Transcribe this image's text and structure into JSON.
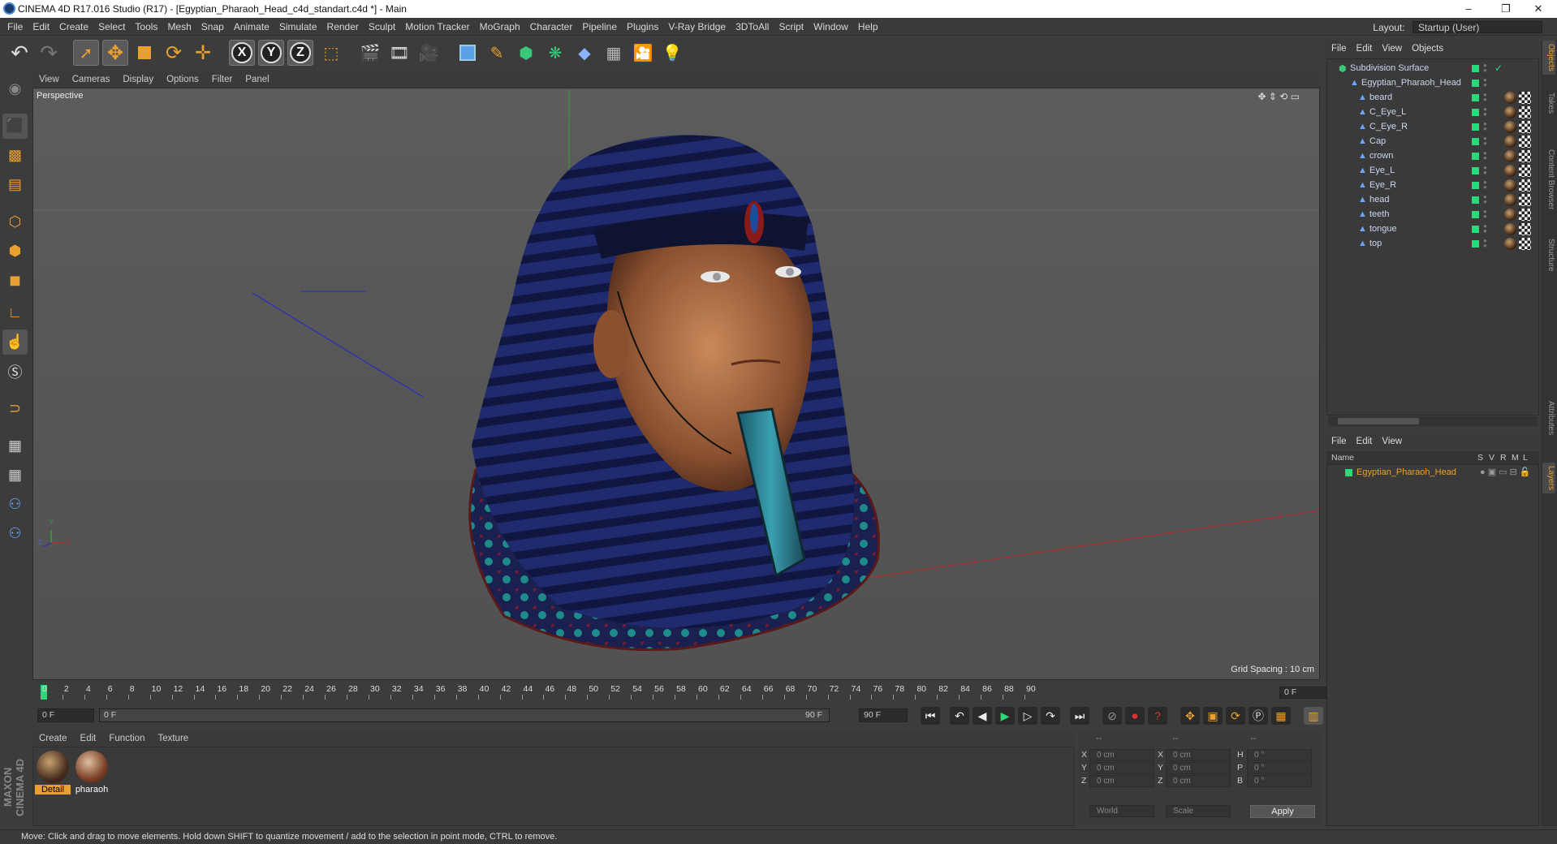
{
  "window": {
    "title": "CINEMA 4D R17.016 Studio (R17) - [Egyptian_Pharaoh_Head_c4d_standart.c4d *] - Main",
    "controls": [
      "–",
      "❐",
      "✕"
    ]
  },
  "menubar": {
    "items": [
      "File",
      "Edit",
      "Create",
      "Select",
      "Tools",
      "Mesh",
      "Snap",
      "Animate",
      "Simulate",
      "Render",
      "Sculpt",
      "Motion Tracker",
      "MoGraph",
      "Character",
      "Pipeline",
      "Plugins",
      "V-Ray Bridge",
      "3DToAll",
      "Script",
      "Window",
      "Help"
    ],
    "layout_label": "Layout:",
    "layout_value": "Startup (User)"
  },
  "toolbar": {
    "axis_x": "X",
    "axis_y": "Y",
    "axis_z": "Z"
  },
  "viewport": {
    "menu": [
      "View",
      "Cameras",
      "Display",
      "Options",
      "Filter",
      "Panel"
    ],
    "label": "Perspective",
    "grid_spacing": "Grid Spacing : 10 cm",
    "axis_y": "Y",
    "axis_x": "X",
    "axis_z": "Z"
  },
  "timeline": {
    "ticks": [
      "0",
      "2",
      "4",
      "6",
      "8",
      "10",
      "12",
      "14",
      "16",
      "18",
      "20",
      "22",
      "24",
      "26",
      "28",
      "30",
      "32",
      "34",
      "36",
      "38",
      "40",
      "42",
      "44",
      "46",
      "48",
      "50",
      "52",
      "54",
      "56",
      "58",
      "60",
      "62",
      "64",
      "66",
      "68",
      "70",
      "72",
      "74",
      "76",
      "78",
      "80",
      "82",
      "84",
      "86",
      "88",
      "90"
    ],
    "current_frame": "0 F",
    "start_field": "0 F",
    "range_start": "0 F",
    "range_end": "90 F",
    "end_field": "90 F"
  },
  "material_manager": {
    "menu": [
      "Create",
      "Edit",
      "Function",
      "Texture"
    ],
    "materials": [
      {
        "name": "Detail",
        "selected": true
      },
      {
        "name": "pharaoh",
        "selected": false
      }
    ]
  },
  "coordinates": {
    "headers": [
      "--",
      "--",
      "--"
    ],
    "rows": [
      {
        "axis": "X",
        "pos": "0 cm",
        "axis2": "X",
        "size": "0 cm",
        "rot_label": "H",
        "rot": "0 °"
      },
      {
        "axis": "Y",
        "pos": "0 cm",
        "axis2": "Y",
        "size": "0 cm",
        "rot_label": "P",
        "rot": "0 °"
      },
      {
        "axis": "Z",
        "pos": "0 cm",
        "axis2": "Z",
        "size": "0 cm",
        "rot_label": "B",
        "rot": "0 °"
      }
    ],
    "mode_world": "World",
    "mode_scale": "Scale",
    "apply": "Apply"
  },
  "status": {
    "text": "Move: Click and drag to move elements. Hold down SHIFT to quantize movement / add to the selection in point mode, CTRL to remove."
  },
  "object_manager": {
    "menu": [
      "File",
      "Edit",
      "View",
      "Objects"
    ],
    "root": "Subdivision Surface",
    "group": "Egyptian_Pharaoh_Head",
    "children": [
      "beard",
      "C_Eye_L",
      "C_Eye_R",
      "Cap",
      "crown",
      "Eye_L",
      "Eye_R",
      "head",
      "teeth",
      "tongue",
      "top"
    ]
  },
  "layer_manager": {
    "menu": [
      "File",
      "Edit",
      "View"
    ],
    "columns": {
      "name": "Name",
      "s": "S",
      "v": "V",
      "r": "R",
      "m": "M",
      "l": "L"
    },
    "layer": "Egyptian_Pharaoh_Head"
  },
  "side_tabs": [
    "Objects",
    "Takes",
    "Content Browser",
    "Structure",
    "Attributes",
    "Layers"
  ],
  "logo": "MAXON CINEMA 4D"
}
